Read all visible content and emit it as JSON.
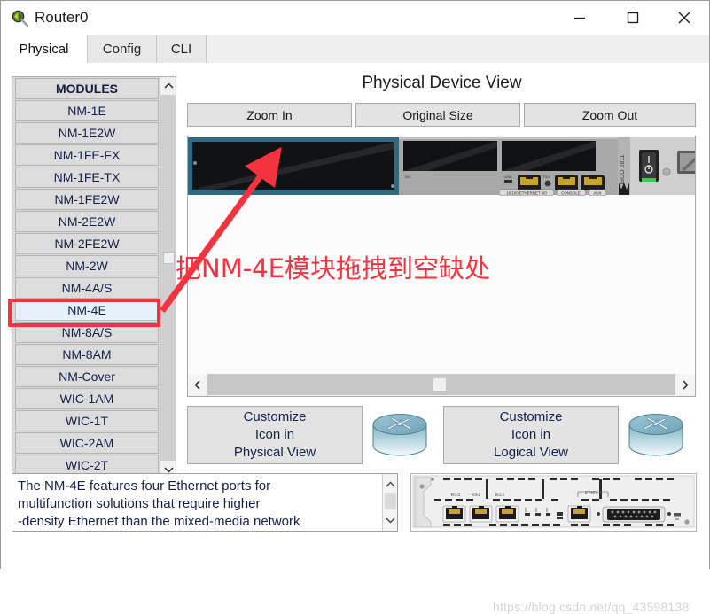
{
  "window": {
    "title": "Router0",
    "icon": "packet-tracer-router-icon",
    "controls": {
      "minimize": "—",
      "maximize": "□",
      "close": "✕"
    }
  },
  "tabs": [
    {
      "id": "physical",
      "label": "Physical",
      "active": true
    },
    {
      "id": "config",
      "label": "Config",
      "active": false
    },
    {
      "id": "cli",
      "label": "CLI",
      "active": false
    }
  ],
  "modules": {
    "header": "MODULES",
    "selected": "NM-4E",
    "items": [
      "NM-1E",
      "NM-1E2W",
      "NM-1FE-FX",
      "NM-1FE-TX",
      "NM-1FE2W",
      "NM-2E2W",
      "NM-2FE2W",
      "NM-2W",
      "NM-4A/S",
      "NM-4E",
      "NM-8A/S",
      "NM-8AM",
      "NM-Cover",
      "WIC-1AM",
      "WIC-1T",
      "WIC-2AM",
      "WIC-2T"
    ]
  },
  "description": {
    "text": "The NM-4E features four Ethernet ports for\n multifunction solutions that require higher\n-density Ethernet than the mixed-media network"
  },
  "device_view": {
    "title": "Physical Device View",
    "buttons": {
      "zoom_in": "Zoom In",
      "original_size": "Original Size",
      "zoom_out": "Zoom Out"
    },
    "chassis_labels": {
      "brand": "CISCO 2811",
      "ethernet": "10/100 ETHERNET 0/0",
      "console": "CONSOLE",
      "aux": "AUX",
      "link": "LINK",
      "fdx": "FDX",
      "w0": "W0",
      "w1": "W1"
    }
  },
  "customize": {
    "physical": "Customize\nIcon in\nPhysical View",
    "physical_lines": [
      "Customize",
      "Icon in",
      "Physical View"
    ],
    "logical_lines": [
      "Customize",
      "Icon in",
      "Logical View"
    ]
  },
  "module_preview": {
    "port_labels": [
      "Eth3",
      "Eth2",
      "Eth1",
      "ETH0"
    ]
  },
  "annotation": {
    "text": "把NM-4E模块拖拽到空缺处",
    "color": "#f5333f",
    "arrow": "arrow-to-empty-slot"
  },
  "watermark": {
    "text": "https://blog.csdn.net/qq_43598138"
  },
  "colors": {
    "accent_red": "#f5333f",
    "selected_blue": "#e8f2fd",
    "button_gray": "#e3e3e3",
    "module_teal": "#2e6b82"
  }
}
